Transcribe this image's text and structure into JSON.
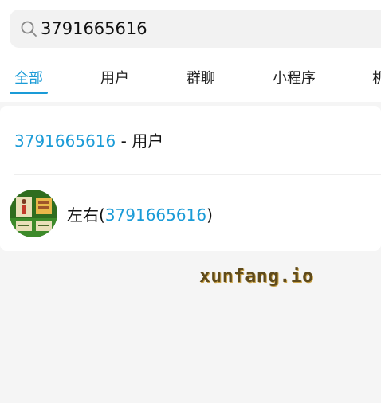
{
  "search": {
    "query": "3791665616"
  },
  "tabs": [
    {
      "label": "全部",
      "active": true
    },
    {
      "label": "用户",
      "active": false
    },
    {
      "label": "群聊",
      "active": false
    },
    {
      "label": "小程序",
      "active": false
    },
    {
      "label": "机",
      "active": false
    }
  ],
  "results": {
    "section_query": "3791665616",
    "section_separator": " - ",
    "section_category": "用户",
    "user": {
      "name": "左右",
      "open_paren": "(",
      "id": "3791665616",
      "close_paren": ")",
      "avatar_icon": "avatar-image"
    }
  },
  "watermark": "xunfang.io",
  "colors": {
    "accent": "#1a9bd7",
    "background": "#f5f5f5",
    "surface": "#ffffff"
  }
}
